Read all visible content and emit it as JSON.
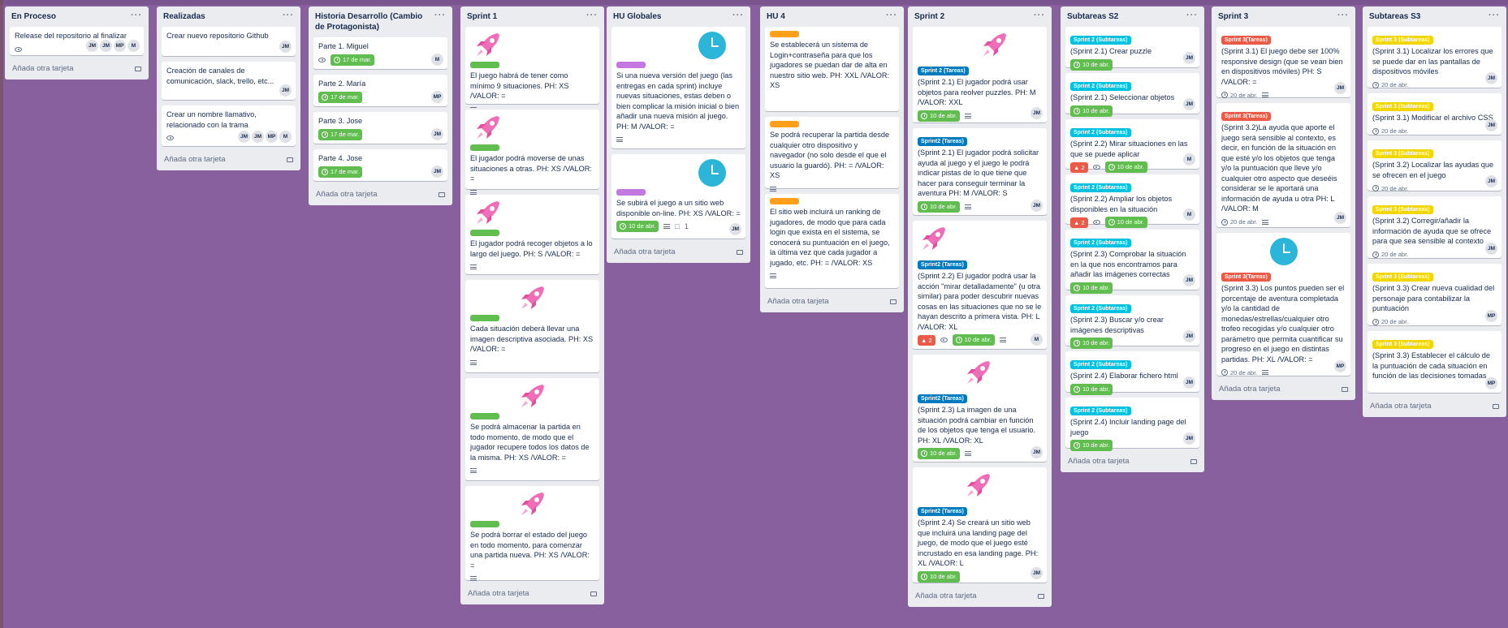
{
  "colors": {
    "green": "#61bd4f",
    "purple": "#c377e0",
    "orange": "#ff9f1a",
    "blue": "#0079bf",
    "sky": "#00c2e0",
    "red": "#eb5a46",
    "yellow": "#f2d600"
  },
  "add_card": "Añada otra tarjeta",
  "lists": [
    {
      "title": "En Proceso",
      "cards": [
        {
          "title": "Release del repositorio al finalizar",
          "members": [
            "JM",
            "JM",
            "MP",
            "M"
          ]
        }
      ]
    },
    {
      "title": "Realizadas",
      "cards": [
        {
          "title": "Crear nuevo repositorio Github",
          "members": [
            "JM"
          ]
        },
        {
          "title": "Creación de canales de comunicación, slack, trello, etc...",
          "members": [
            "JM"
          ]
        },
        {
          "title": "Crear un nombre llamativo, relacionado con la trama",
          "members": [
            "JM",
            "JM",
            "MP",
            "M"
          ]
        }
      ]
    },
    {
      "title": "Historia Desarrollo (Cambio de Protagonista)",
      "cards": [
        {
          "title": "Parte 1. Miguel",
          "due": "17 de mar.",
          "members": [
            "M"
          ]
        },
        {
          "title": "Parte 2. María",
          "due": "17 de mar.",
          "members": [
            "MP"
          ]
        },
        {
          "title": "Parte 3. Jose",
          "due": "17 de mar.",
          "members": [
            "JM"
          ]
        },
        {
          "title": "Parte 4. Jose",
          "due": "17 de mar.",
          "members": [
            "JM"
          ]
        }
      ]
    },
    {
      "title": "Sprint 1",
      "cards": [
        {
          "title": "El juego habrá de tener como mínimo 9 situaciones. PH: XS /VALOR: ="
        },
        {
          "title": "El jugador podrá moverse de unas situaciones a otras. PH: XS /VALOR: ="
        },
        {
          "title": "El jugador podrá recoger objetos a lo largo del juego. PH: S /VALOR: ="
        },
        {
          "title": "Cada situación deberá llevar una imagen descriptiva asociada. PH: XS /VALOR: ="
        },
        {
          "title": "Se podrá almacenar la partida en todo momento, de modo que el jugador recupere todos los datos de la misma. PH: XS /VALOR: ="
        },
        {
          "title": "Se podrá borrar el estado del juego en todo momento, para comenzar una partida nueva. PH: XS /VALOR: ="
        }
      ]
    },
    {
      "title": "HU Globales",
      "cards": [
        {
          "title": "Si una nueva versión del juego (las entregas en cada sprint) incluye nuevas situaciones, estas deben o bien complicar la misión inicial o bien añadir una nueva misión al juego. PH: M /VALOR: ="
        },
        {
          "title": "Se subirá el juego a un sitio web disponible on-line. PH: XS /VALOR: =",
          "due": "10 de abr.",
          "comments": "1",
          "members": [
            "JM"
          ]
        }
      ]
    },
    {
      "title": "HU 4",
      "cards": [
        {
          "title": "Se establecerá un sistema de Login+contraseña para que los jugadores se puedan dar de alta en nuestro sitio web. PH: XXL /VALOR: XS"
        },
        {
          "title": "Se podrá recuperar la partida desde cualquier otro dispositivo y navegador (no solo desde el que el usuario la guardó). PH: = /VALOR: XS"
        },
        {
          "title": "El sitio web incluirá un ranking de jugadores, de modo que para cada login que exista en el sistema, se conocerá su puntuación en el juego, la última vez que cada jugador a jugado, etc. PH: = /VALOR: XS"
        }
      ]
    },
    {
      "title": "Sprint 2",
      "cards": [
        {
          "label": "Sprint 2 (Tareas)",
          "title": "(Sprint 2.1) El jugador podrá usar objetos para reolver puzzles. PH: M /VALOR: XXL",
          "due": "10 de abr.",
          "members": [
            "JM"
          ]
        },
        {
          "label": "Sprint2 (Tareas)",
          "title": "(Sprint 2.1) El jugador podrá solicitar ayuda al juego y el juego le podrá indicar pistas de lo que tiene que hacer para conseguir terminar la aventura PH: M /VALOR: S",
          "due": "10 de abr.",
          "members": [
            "JM"
          ]
        },
        {
          "label": "Sprint2 (Tareas)",
          "title": "(Sprint 2.2) El jugador podrá usar la acción \"mirar detalladamente\" (u otra similar) para poder descubrir nuevas cosas en las situaciones que no se le hayan descrito a primera vista. PH: L /VALOR: XL",
          "alarm": "2",
          "due": "10 de abr.",
          "members": [
            "M"
          ]
        },
        {
          "label": "Sprint2 (Tareas)",
          "title": "(Sprint 2.3) La imagen de una situación podrá cambiar en función de los objetos que tenga el usuario. PH: XL /VALOR: XL",
          "due": "10 de abr.",
          "members": [
            "JM"
          ]
        },
        {
          "label": "Sprint2 (Tareas)",
          "title": "(Sprint 2.4) Se creará un sitio web que incluirá una landing page del juego, de modo que el juego esté incrustado en esa landing page. PH: XL /VALOR: L",
          "due": "10 de abr.",
          "members": [
            "JM"
          ]
        }
      ]
    },
    {
      "title": "Subtareas S2",
      "cards": [
        {
          "label": "Sprint 2 (Subtareas)",
          "title": "(Sprint 2.1) Crear puzzle",
          "due": "10 de abr.",
          "members": [
            "JM"
          ]
        },
        {
          "label": "Sprint 2 (Subtareas)",
          "title": "(Sprint 2.1) Seleccionar objetos",
          "due": "10 de abr.",
          "members": [
            "JM"
          ]
        },
        {
          "label": "Sprint 2 (Subtareas)",
          "title": "(Sprint 2.2) Mirar situaciones en las que se puede aplicar",
          "alarm": "2",
          "due": "10 de abr.",
          "members": [
            "M"
          ]
        },
        {
          "label": "Sprint 2 (Subtareas)",
          "title": "(Sprint 2.2) Ampliar los objetos disponibles en la situación",
          "alarm": "2",
          "due": "10 de abr.",
          "members": [
            "M"
          ]
        },
        {
          "label": "Sprint 2 (Subtareas)",
          "title": "(Sprint 2.3) Comprobar la situación en la que nos encontramos para añadir las imágenes correctas",
          "due": "10 de abr.",
          "members": [
            "JM"
          ]
        },
        {
          "label": "Sprint 2 (Subtareas)",
          "title": "(Sprint 2.3) Buscar y/o crear imágenes descriptivas",
          "due": "10 de abr.",
          "members": [
            "JM"
          ]
        },
        {
          "label": "Sprint 2 (Subtareas)",
          "title": "(Sprint 2.4) Elaborar fichero html",
          "due": "10 de abr.",
          "members": [
            "JM"
          ]
        },
        {
          "label": "Sprint 2 (Subtareas)",
          "title": "(Sprint 2.4) Incluir landing page del juego",
          "due": "10 de abr.",
          "members": [
            "JM"
          ]
        }
      ]
    },
    {
      "title": "Sprint 3",
      "cards": [
        {
          "label": "Sprint 3(Tareas)",
          "title": "(Sprint 3.1) El juego debe ser 100% responsive design (que se vean bien en dispositivos móviles) PH: S /VALOR: =",
          "due": "20 de abr.",
          "members": [
            "JM"
          ]
        },
        {
          "label": "Sprint 3(Tareas)",
          "title": "(Sprint 3.2)La ayuda que aporte el juego será sensible al contexto, es decir, en función de la situación en que esté y/o los objetos que tenga y/o la puntuación que lleve y/o cualquier otro aspecto que deseéis considerar se le aportará una información de ayuda u otra PH: L /VALOR: M",
          "due": "20 de abr.",
          "members": [
            "JM"
          ]
        },
        {
          "label": "Sprint 3(Tareas)",
          "title": "(Sprint 3.3) Los puntos pueden ser el porcentaje de aventura completada y/o la cantidad de monedas/estrellas/cualquier otro trofeo recogidas y/o cualquier otro parámetro que permita cuantificar su progreso en el juego en distintas partidas. PH: XL /VALOR: =",
          "due": "20 de abr.",
          "members": [
            "MP"
          ]
        }
      ]
    },
    {
      "title": "Subtareas S3",
      "cards": [
        {
          "label": "Sprint 3 (Subtareas)",
          "title": "(Sprint 3.1) Localizar los errores que se puede dar en las pantallas de dispositivos móviles",
          "due": "20 de abr.",
          "members": [
            "JM"
          ]
        },
        {
          "label": "Sprint 3 (Subtareas)",
          "title": "(Sprint 3.1) Modificar el archivo CSS",
          "due": "20 de abr.",
          "members": [
            "JM"
          ]
        },
        {
          "label": "Sprint 3 (Subtareas)",
          "title": "(Sprint 3.2) Localizar las ayudas que se ofrecen en el juego",
          "due": "20 de abr.",
          "members": [
            "JM"
          ]
        },
        {
          "label": "Sprint 3 (Subtareas)",
          "title": "(Sprint 3.2) Corregir/añadir la información de ayuda que se ofrece para que sea sensible al contexto",
          "due": "20 de abr.",
          "members": [
            "JM"
          ]
        },
        {
          "label": "Sprint 3 (Subtareas)",
          "title": "(Sprint 3.3) Crear nueva cualidad del personaje para contabilizar la puntuación",
          "due": "20 de abr.",
          "members": [
            "MP"
          ]
        },
        {
          "label": "Sprint 3 (Subtareas)",
          "title": "(Sprint 3.3) Establecer el cálculo de la puntuación de cada situación en función de las decisiones tomadas",
          "due": "20 de abr.",
          "members": [
            "MP"
          ]
        }
      ]
    }
  ]
}
